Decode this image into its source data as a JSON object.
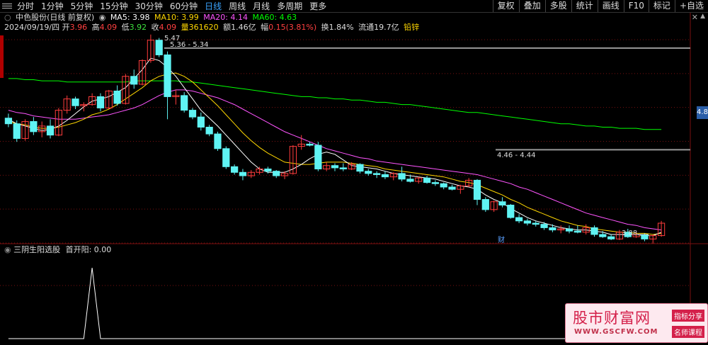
{
  "toolbar": {
    "tabs": [
      "分时",
      "1分钟",
      "5分钟",
      "15分钟",
      "30分钟",
      "60分钟",
      "日线",
      "周线",
      "月线",
      "多周期",
      "更多"
    ],
    "active_tab": "日线",
    "right_buttons": [
      "复权",
      "叠加",
      "多股",
      "统计",
      "画线",
      "F10",
      "标记",
      "+自选"
    ]
  },
  "legend": {
    "title": "中色股份(日线 前复权)",
    "ma5": "MA5: 3.98",
    "ma10": "MA10: 3.99",
    "ma20": "MA20: 4.14",
    "ma60": "MA60: 4.63",
    "colors": {
      "ma5": "#ffffff",
      "ma10": "#ffd700",
      "ma20": "#ff55ff",
      "ma60": "#00ff00"
    }
  },
  "ohlc": {
    "date": "2024/09/19/四",
    "open_label": "开",
    "open": "3.96",
    "high_label": "高",
    "high": "4.09",
    "low_label": "低",
    "low": "3.92",
    "close_label": "收",
    "close": "4.09",
    "volume": "量361620",
    "amount": "额1.46亿",
    "change_label": "幅",
    "change": "0.15(3.81%)",
    "turnover": "换1.84%",
    "float": "流通19.7亿",
    "sector": "铅锌"
  },
  "annotations": {
    "high_price": "5.47",
    "range_top": "5.36 - 5.34",
    "range_mid": "4.46 - 4.44",
    "low_price": "3.88",
    "fin_badge": "财",
    "price_tag": "4.8"
  },
  "sub_panel": {
    "indicator": "三阴生阳选股",
    "value_label": "首开阳: 0.00"
  },
  "watermark": {
    "name": "股市财富网",
    "url": "WWW.GSCFW.COM",
    "badge1": "指标分享",
    "badge2": "名师课程"
  },
  "chart_data": {
    "type": "candlestick",
    "y_range": [
      3.75,
      5.55
    ],
    "colors": {
      "up": "#ff3c3c",
      "down": "#5ff3f3"
    },
    "candles": [
      [
        4.73,
        4.77,
        4.65,
        4.68
      ],
      [
        4.68,
        4.71,
        4.52,
        4.55
      ],
      [
        4.55,
        4.72,
        4.53,
        4.7
      ],
      [
        4.7,
        4.74,
        4.58,
        4.61
      ],
      [
        4.61,
        4.7,
        4.56,
        4.66
      ],
      [
        4.66,
        4.72,
        4.55,
        4.58
      ],
      [
        4.58,
        4.82,
        4.57,
        4.8
      ],
      [
        4.8,
        4.93,
        4.77,
        4.9
      ],
      [
        4.9,
        4.92,
        4.81,
        4.84
      ],
      [
        4.84,
        4.87,
        4.79,
        4.85
      ],
      [
        4.85,
        4.95,
        4.84,
        4.92
      ],
      [
        4.92,
        4.95,
        4.79,
        4.82
      ],
      [
        4.82,
        4.98,
        4.81,
        4.97
      ],
      [
        4.97,
        5.02,
        4.84,
        4.86
      ],
      [
        4.86,
        5.12,
        4.85,
        5.1
      ],
      [
        5.1,
        5.16,
        4.99,
        5.03
      ],
      [
        5.03,
        5.25,
        5.02,
        5.24
      ],
      [
        5.24,
        5.47,
        5.22,
        5.42
      ],
      [
        5.42,
        5.44,
        5.27,
        5.29
      ],
      [
        5.29,
        5.32,
        4.72,
        4.92
      ],
      [
        4.92,
        4.98,
        4.85,
        4.93
      ],
      [
        4.93,
        4.96,
        4.78,
        4.8
      ],
      [
        4.8,
        4.82,
        4.72,
        4.74
      ],
      [
        4.74,
        4.78,
        4.62,
        4.65
      ],
      [
        4.65,
        4.67,
        4.57,
        4.59
      ],
      [
        4.59,
        4.61,
        4.44,
        4.46
      ],
      [
        4.46,
        4.48,
        4.28,
        4.3
      ],
      [
        4.3,
        4.32,
        4.23,
        4.25
      ],
      [
        4.25,
        4.28,
        4.18,
        4.22
      ],
      [
        4.22,
        4.27,
        4.2,
        4.25
      ],
      [
        4.25,
        4.3,
        4.23,
        4.28
      ],
      [
        4.28,
        4.3,
        4.24,
        4.26
      ],
      [
        4.26,
        4.27,
        4.2,
        4.22
      ],
      [
        4.22,
        4.26,
        4.19,
        4.24
      ],
      [
        4.24,
        4.49,
        4.23,
        4.48
      ],
      [
        4.48,
        4.58,
        4.45,
        4.5
      ],
      [
        4.5,
        4.52,
        4.48,
        4.49
      ],
      [
        4.49,
        4.52,
        4.26,
        4.28
      ],
      [
        4.28,
        4.34,
        4.26,
        4.31
      ],
      [
        4.31,
        4.33,
        4.26,
        4.29
      ],
      [
        4.29,
        4.33,
        4.26,
        4.28
      ],
      [
        4.28,
        4.34,
        4.27,
        4.32
      ],
      [
        4.32,
        4.33,
        4.24,
        4.26
      ],
      [
        4.26,
        4.28,
        4.22,
        4.24
      ],
      [
        4.24,
        4.26,
        4.2,
        4.23
      ],
      [
        4.23,
        4.26,
        4.19,
        4.21
      ],
      [
        4.21,
        4.25,
        4.18,
        4.24
      ],
      [
        4.24,
        4.3,
        4.17,
        4.19
      ],
      [
        4.19,
        4.23,
        4.16,
        4.17
      ],
      [
        4.17,
        4.21,
        4.15,
        4.2
      ],
      [
        4.2,
        4.22,
        4.15,
        4.16
      ],
      [
        4.16,
        4.18,
        4.13,
        4.15
      ],
      [
        4.15,
        4.16,
        4.1,
        4.12
      ],
      [
        4.12,
        4.14,
        4.09,
        4.1
      ],
      [
        4.1,
        4.14,
        4.06,
        4.13
      ],
      [
        4.13,
        4.2,
        4.12,
        4.18
      ],
      [
        4.18,
        4.19,
        3.96,
        4.01
      ],
      [
        4.01,
        4.03,
        3.9,
        3.92
      ],
      [
        3.92,
        4.0,
        3.9,
        3.99
      ],
      [
        3.99,
        4.03,
        3.94,
        3.96
      ],
      [
        3.96,
        3.97,
        3.84,
        3.85
      ],
      [
        3.85,
        3.88,
        3.8,
        3.82
      ],
      [
        3.82,
        3.84,
        3.78,
        3.8
      ],
      [
        3.8,
        3.82,
        3.77,
        3.79
      ],
      [
        3.79,
        3.81,
        3.74,
        3.76
      ],
      [
        3.76,
        3.79,
        3.72,
        3.74
      ],
      [
        3.74,
        3.78,
        3.71,
        3.75
      ],
      [
        3.75,
        3.78,
        3.71,
        3.73
      ],
      [
        3.73,
        3.78,
        3.71,
        3.72
      ],
      [
        3.72,
        3.79,
        3.7,
        3.76
      ],
      [
        3.76,
        3.78,
        3.68,
        3.7
      ],
      [
        3.7,
        3.73,
        3.67,
        3.68
      ],
      [
        3.68,
        3.7,
        3.65,
        3.66
      ],
      [
        3.66,
        3.74,
        3.65,
        3.72
      ],
      [
        3.72,
        3.75,
        3.67,
        3.68
      ],
      [
        3.68,
        3.72,
        3.67,
        3.7
      ],
      [
        3.7,
        3.71,
        3.64,
        3.66
      ],
      [
        3.66,
        3.7,
        3.62,
        3.69
      ],
      [
        3.69,
        3.82,
        3.68,
        3.8
      ]
    ],
    "ma5": [
      4.72,
      4.68,
      4.66,
      4.64,
      4.62,
      4.63,
      4.66,
      4.71,
      4.77,
      4.83,
      4.88,
      4.9,
      4.92,
      4.96,
      5.0,
      5.08,
      5.16,
      5.26,
      5.24,
      5.18,
      5.1,
      5.0,
      4.9,
      4.8,
      4.73,
      4.66,
      4.58,
      4.5,
      4.42,
      4.34,
      4.28,
      4.25,
      4.25,
      4.25,
      4.28,
      4.32,
      4.37,
      4.41,
      4.43,
      4.41,
      4.36,
      4.31,
      4.3,
      4.29,
      4.28,
      4.26,
      4.24,
      4.23,
      4.22,
      4.21,
      4.2,
      4.19,
      4.17,
      4.15,
      4.13,
      4.12,
      4.1,
      4.05,
      4.01,
      3.98,
      3.93,
      3.89,
      3.85,
      3.82,
      3.8,
      3.78,
      3.76,
      3.75,
      3.74,
      3.74,
      3.73,
      3.72,
      3.7,
      3.7,
      3.7,
      3.7,
      3.69,
      3.69,
      3.72
    ],
    "ma10": [
      4.7,
      4.68,
      4.67,
      4.65,
      4.64,
      4.64,
      4.65,
      4.67,
      4.69,
      4.72,
      4.76,
      4.78,
      4.81,
      4.85,
      4.9,
      4.95,
      5.0,
      5.06,
      5.1,
      5.12,
      5.13,
      5.1,
      5.05,
      4.98,
      4.91,
      4.84,
      4.76,
      4.68,
      4.6,
      4.53,
      4.47,
      4.42,
      4.38,
      4.34,
      4.33,
      4.32,
      4.32,
      4.33,
      4.34,
      4.34,
      4.34,
      4.33,
      4.32,
      4.31,
      4.3,
      4.28,
      4.27,
      4.26,
      4.25,
      4.24,
      4.23,
      4.22,
      4.21,
      4.19,
      4.17,
      4.16,
      4.14,
      4.11,
      4.08,
      4.05,
      4.01,
      3.98,
      3.94,
      3.91,
      3.88,
      3.85,
      3.82,
      3.8,
      3.78,
      3.77,
      3.75,
      3.74,
      3.73,
      3.72,
      3.72,
      3.71,
      3.71,
      3.7,
      3.71
    ],
    "ma20": [
      4.8,
      4.78,
      4.77,
      4.75,
      4.74,
      4.73,
      4.72,
      4.72,
      4.72,
      4.73,
      4.74,
      4.75,
      4.76,
      4.78,
      4.8,
      4.82,
      4.85,
      4.89,
      4.93,
      4.96,
      4.98,
      4.98,
      4.97,
      4.95,
      4.93,
      4.91,
      4.88,
      4.85,
      4.81,
      4.77,
      4.73,
      4.69,
      4.65,
      4.61,
      4.58,
      4.55,
      4.52,
      4.49,
      4.46,
      4.44,
      4.42,
      4.4,
      4.38,
      4.37,
      4.35,
      4.34,
      4.33,
      4.32,
      4.31,
      4.3,
      4.29,
      4.28,
      4.27,
      4.26,
      4.25,
      4.24,
      4.23,
      4.21,
      4.19,
      4.17,
      4.15,
      4.12,
      4.1,
      4.07,
      4.04,
      4.01,
      3.98,
      3.95,
      3.92,
      3.89,
      3.87,
      3.85,
      3.83,
      3.81,
      3.79,
      3.78,
      3.76,
      3.75,
      3.74
    ],
    "ma60": [
      5.08,
      5.08,
      5.07,
      5.07,
      5.06,
      5.06,
      5.06,
      5.05,
      5.05,
      5.05,
      5.05,
      5.05,
      5.05,
      5.05,
      5.05,
      5.06,
      5.06,
      5.06,
      5.06,
      5.06,
      5.06,
      5.05,
      5.05,
      5.04,
      5.03,
      5.02,
      5.01,
      5.0,
      4.99,
      4.98,
      4.97,
      4.96,
      4.95,
      4.94,
      4.93,
      4.92,
      4.92,
      4.91,
      4.91,
      4.9,
      4.9,
      4.89,
      4.89,
      4.88,
      4.87,
      4.87,
      4.86,
      4.85,
      4.85,
      4.84,
      4.83,
      4.82,
      4.81,
      4.8,
      4.79,
      4.78,
      4.78,
      4.77,
      4.76,
      4.75,
      4.74,
      4.73,
      4.72,
      4.71,
      4.7,
      4.69,
      4.68,
      4.68,
      4.67,
      4.66,
      4.66,
      4.65,
      4.65,
      4.64,
      4.64,
      4.64,
      4.63,
      4.63,
      4.63
    ],
    "h_lines": [
      5.35,
      4.45
    ],
    "signal": {
      "range": [
        0,
        1
      ],
      "values": [
        0,
        0,
        0,
        0,
        0,
        0,
        0,
        0,
        0,
        0,
        0,
        0,
        0,
        0,
        0,
        0,
        0,
        0,
        0,
        0,
        0,
        0,
        0,
        0,
        0,
        0,
        0,
        0,
        0,
        0,
        0,
        0,
        0,
        0,
        0,
        0,
        0,
        0,
        0,
        0,
        0,
        0,
        0,
        0,
        0,
        0,
        0,
        0,
        0,
        0,
        0,
        0,
        0,
        0,
        0,
        0,
        0,
        0,
        0,
        0,
        0,
        0,
        0,
        0,
        0,
        0,
        0,
        0,
        0,
        0,
        0,
        0,
        0,
        0,
        0,
        0,
        0,
        0,
        0
      ],
      "spike_index": 10,
      "spike_value": 1
    }
  }
}
